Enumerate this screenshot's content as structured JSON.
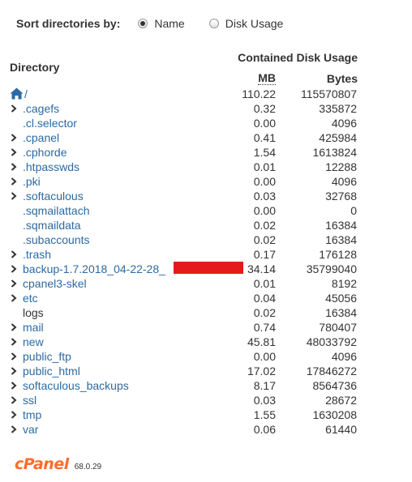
{
  "sort": {
    "label": "Sort directories by:",
    "options": [
      {
        "label": "Name",
        "checked": true
      },
      {
        "label": "Disk Usage",
        "checked": false
      }
    ]
  },
  "table": {
    "dir_header": "Directory",
    "usage_header": "Contained Disk Usage",
    "mb_header": "MB",
    "bytes_header": "Bytes",
    "rows": [
      {
        "name": "/",
        "mb": "110.22",
        "bytes": "115570807",
        "expandable": false,
        "root": true,
        "link": true
      },
      {
        "name": ".cagefs",
        "mb": "0.32",
        "bytes": "335872",
        "expandable": true,
        "link": true
      },
      {
        "name": ".cl.selector",
        "mb": "0.00",
        "bytes": "4096",
        "expandable": false,
        "link": true
      },
      {
        "name": ".cpanel",
        "mb": "0.41",
        "bytes": "425984",
        "expandable": true,
        "link": true
      },
      {
        "name": ".cphorde",
        "mb": "1.54",
        "bytes": "1613824",
        "expandable": true,
        "link": true
      },
      {
        "name": ".htpasswds",
        "mb": "0.01",
        "bytes": "12288",
        "expandable": true,
        "link": true
      },
      {
        "name": ".pki",
        "mb": "0.00",
        "bytes": "4096",
        "expandable": true,
        "link": true
      },
      {
        "name": ".softaculous",
        "mb": "0.03",
        "bytes": "32768",
        "expandable": true,
        "link": true
      },
      {
        "name": ".sqmailattach",
        "mb": "0.00",
        "bytes": "0",
        "expandable": false,
        "link": true
      },
      {
        "name": ".sqmaildata",
        "mb": "0.02",
        "bytes": "16384",
        "expandable": false,
        "link": true
      },
      {
        "name": ".subaccounts",
        "mb": "0.02",
        "bytes": "16384",
        "expandable": false,
        "link": true
      },
      {
        "name": ".trash",
        "mb": "0.17",
        "bytes": "176128",
        "expandable": true,
        "link": true
      },
      {
        "name": "backup-1.7.2018_04-22-28_",
        "mb": "34.14",
        "bytes": "35799040",
        "expandable": true,
        "link": true,
        "redacted": true
      },
      {
        "name": "cpanel3-skel",
        "mb": "0.01",
        "bytes": "8192",
        "expandable": true,
        "link": true
      },
      {
        "name": "etc",
        "mb": "0.04",
        "bytes": "45056",
        "expandable": true,
        "link": true
      },
      {
        "name": "logs",
        "mb": "0.02",
        "bytes": "16384",
        "expandable": false,
        "link": false
      },
      {
        "name": "mail",
        "mb": "0.74",
        "bytes": "780407",
        "expandable": true,
        "link": true
      },
      {
        "name": "new",
        "mb": "45.81",
        "bytes": "48033792",
        "expandable": true,
        "link": true
      },
      {
        "name": "public_ftp",
        "mb": "0.00",
        "bytes": "4096",
        "expandable": true,
        "link": true
      },
      {
        "name": "public_html",
        "mb": "17.02",
        "bytes": "17846272",
        "expandable": true,
        "link": true
      },
      {
        "name": "softaculous_backups",
        "mb": "8.17",
        "bytes": "8564736",
        "expandable": true,
        "link": true
      },
      {
        "name": "ssl",
        "mb": "0.03",
        "bytes": "28672",
        "expandable": true,
        "link": true
      },
      {
        "name": "tmp",
        "mb": "1.55",
        "bytes": "1630208",
        "expandable": true,
        "link": true
      },
      {
        "name": "var",
        "mb": "0.06",
        "bytes": "61440",
        "expandable": true,
        "link": true
      }
    ]
  },
  "footer": {
    "logo_text": "cPanel",
    "version": "68.0.29"
  },
  "colors": {
    "link": "#2b6aa3",
    "brand": "#ff6c2c",
    "redaction": "#e51b1b"
  },
  "icons": {
    "root": "home-icon",
    "expand": "chevron-right-icon"
  }
}
